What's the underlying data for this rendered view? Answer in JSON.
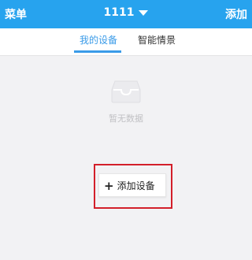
{
  "header": {
    "menu_label": "菜单",
    "title": "1111",
    "add_label": "添加",
    "bg_color": "#27a3ee"
  },
  "tabs": [
    {
      "label": "我的设备",
      "active": true
    },
    {
      "label": "智能情景",
      "active": false
    }
  ],
  "accent_color": "#3a9be8",
  "empty_state": {
    "icon": "inbox-tray-icon",
    "text": "暂无数据"
  },
  "add_device": {
    "icon": "plus-icon",
    "label": "添加设备",
    "highlight_color": "#d31f2a"
  }
}
